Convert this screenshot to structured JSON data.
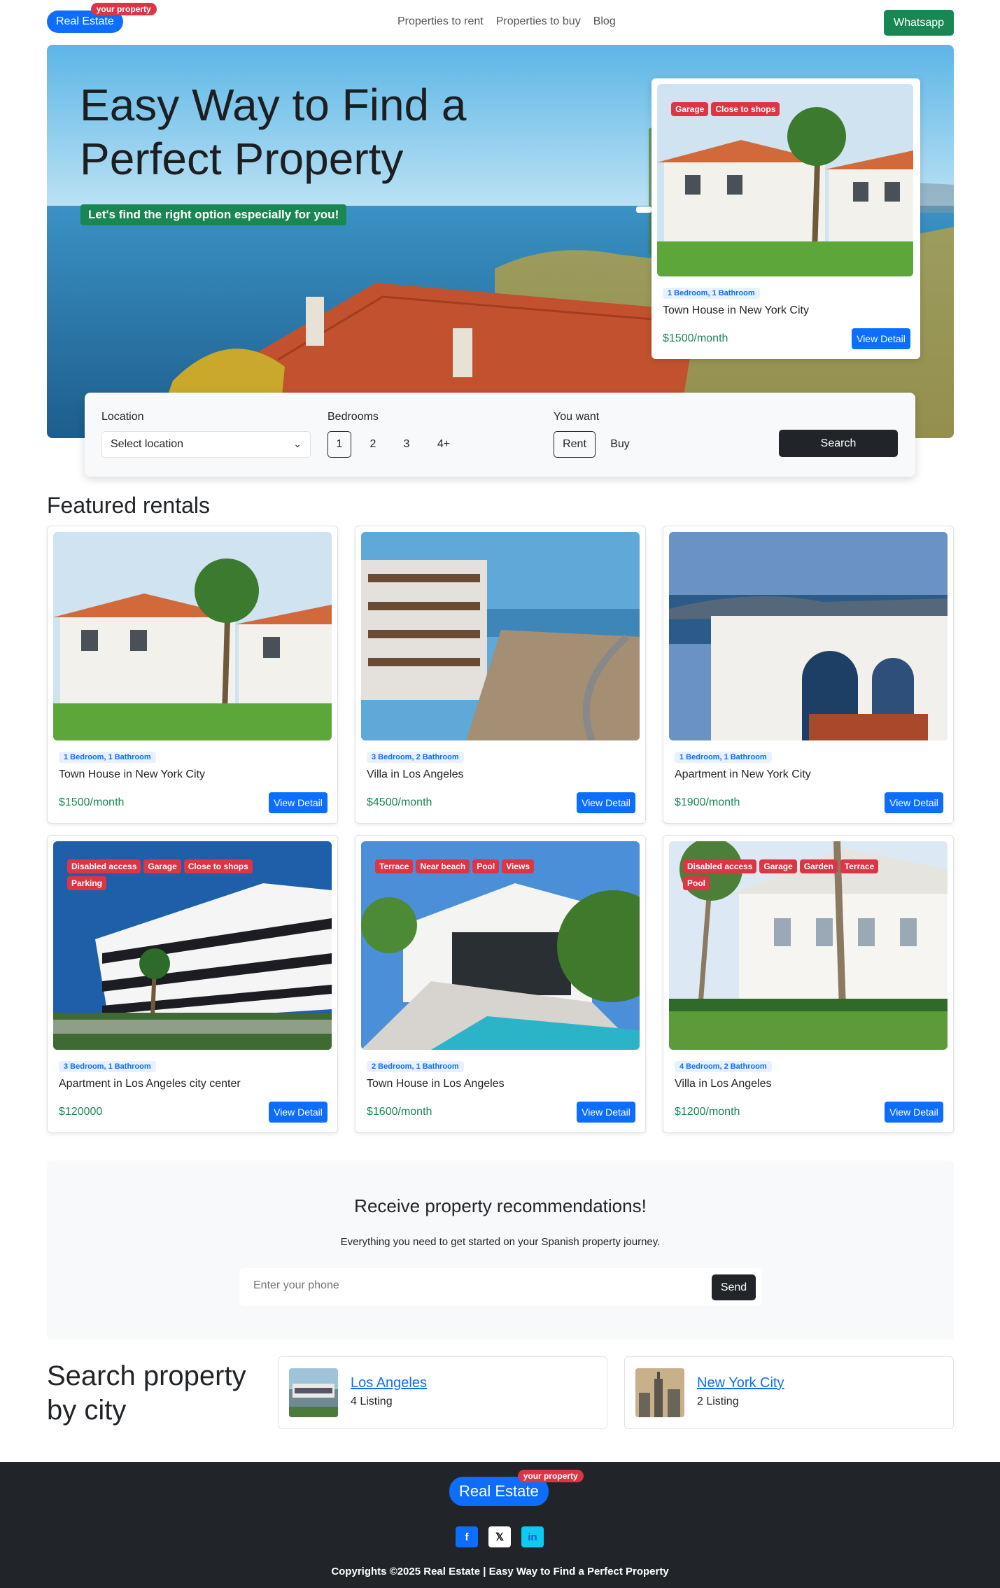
{
  "brand": {
    "name": "Real Estate",
    "badge": "your property"
  },
  "nav": {
    "links": [
      "Properties to rent",
      "Properties to buy",
      "Blog"
    ],
    "whatsapp": "Whatsapp"
  },
  "hero": {
    "title": "Easy Way to Find a Perfect Property",
    "subtitle": "Let's find the right option especially for you!",
    "card": {
      "tags": [
        "Garage",
        "Close to shops"
      ],
      "beds": "1 Bedroom, 1 Bathroom",
      "title": "Town House in New York City",
      "price": "$1500",
      "period": "/month",
      "button": "View Detail"
    }
  },
  "search": {
    "location_label": "Location",
    "location_value": "Select location",
    "bedrooms_label": "Bedrooms",
    "bedrooms": [
      "1",
      "2",
      "3",
      "4+"
    ],
    "want_label": "You want",
    "want_options": [
      "Rent",
      "Buy"
    ],
    "button": "Search"
  },
  "featured": {
    "title": "Featured rentals",
    "cards": [
      {
        "tags": [],
        "beds": "1 Bedroom, 1 Bathroom",
        "title": "Town House in New York City",
        "price": "$1500",
        "period": "/month",
        "button": "View Detail"
      },
      {
        "tags": [],
        "beds": "3 Bedroom, 2 Bathroom",
        "title": "Villa in Los Angeles",
        "price": "$4500",
        "period": "/month",
        "button": "View Detail"
      },
      {
        "tags": [],
        "beds": "1 Bedroom, 1 Bathroom",
        "title": "Apartment in New York City",
        "price": "$1900",
        "period": "/month",
        "button": "View Detail"
      },
      {
        "tags": [
          "Disabled access",
          "Garage",
          "Close to shops",
          "Parking"
        ],
        "beds": "3 Bedroom, 1 Bathroom",
        "title": "Apartment in Los Angeles city center",
        "price": "$120000",
        "period": "",
        "button": "View Detail"
      },
      {
        "tags": [
          "Terrace",
          "Near beach",
          "Pool",
          "Views"
        ],
        "beds": "2 Bedroom, 1 Bathroom",
        "title": "Town House in Los Angeles",
        "price": "$1600",
        "period": "/month",
        "button": "View Detail"
      },
      {
        "tags": [
          "Disabled access",
          "Garage",
          "Garden",
          "Terrace",
          "Pool"
        ],
        "beds": "4 Bedroom, 2 Bathroom",
        "title": "Villa in Los Angeles",
        "price": "$1200",
        "period": "/month",
        "button": "View Detail"
      }
    ]
  },
  "newsletter": {
    "title": "Receive property recommendations!",
    "text": "Everything you need to get started on your Spanish property journey.",
    "placeholder": "Enter your phone",
    "button": "Send"
  },
  "cities": {
    "title": "Search property by city",
    "items": [
      {
        "name": "Los Angeles",
        "count": "4 Listing"
      },
      {
        "name": "New York City",
        "count": "2 Listing"
      }
    ]
  },
  "footer": {
    "social": [
      "facebook-icon",
      "x-icon",
      "linkedin-icon"
    ],
    "copyright": "Copyrights ©2025 Real Estate | Easy Way to Find a Perfect Property"
  }
}
